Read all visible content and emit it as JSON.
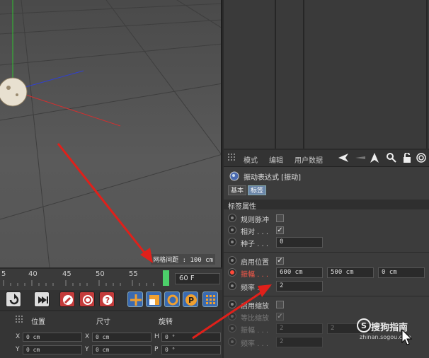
{
  "viewport": {
    "grid_status": "网格间距 : 100 cm"
  },
  "attribute_manager": {
    "menu": {
      "mode": "模式",
      "edit": "编辑",
      "user_data": "用户数据"
    },
    "tag_title": "振动表达式 [振动]",
    "tabs": {
      "basic": "基本",
      "tag": "标签"
    },
    "section_title": "标签属性",
    "params": {
      "regular_pulse": {
        "label": "规则脉冲",
        "checked": false
      },
      "relative": {
        "label": "相对 . . .",
        "checked": true
      },
      "seed": {
        "label": "种子 . . .",
        "value": "0"
      },
      "enable_position": {
        "label": "启用位置",
        "checked": true
      },
      "amplitude": {
        "label": "振幅 . . .",
        "x": "600 cm",
        "y": "500 cm",
        "z": "0 cm"
      },
      "frequency": {
        "label": "频率 . . .",
        "value": "2"
      },
      "enable_scale": {
        "label": "启用缩放",
        "checked": false
      },
      "uniform_scale": {
        "label": "等比缩放",
        "checked": true
      },
      "scale_amplitude": {
        "label": "振幅 . . .",
        "x": "2",
        "y": "2"
      },
      "scale_frequency": {
        "label": "频率 . . .",
        "value": "2"
      }
    }
  },
  "timeline": {
    "ticks": [
      "5",
      "40",
      "45",
      "50",
      "55"
    ],
    "frame_field": "60 F",
    "playhead_frame": 58
  },
  "coordinates": {
    "headers": {
      "position": "位置",
      "size": "尺寸",
      "rotation": "旋转"
    },
    "position": {
      "x_label": "X",
      "x": "0 cm",
      "y_label": "Y",
      "y": "0 cm"
    },
    "size": {
      "x_label": "X",
      "x": "0 cm",
      "y_label": "Y",
      "y": "0 cm"
    },
    "rotation": {
      "h_label": "H",
      "h": "0 °",
      "p_label": "P",
      "p": "0 °"
    }
  },
  "watermark": {
    "title": "搜狗指南",
    "url": "zhinan.sogou.com"
  },
  "colors": {
    "annotation_arrow": "#e0201a",
    "playhead": "#4cd06a",
    "active_tab": "#6a85a8",
    "axis_x": "#d03030",
    "axis_y": "#30c030",
    "axis_z": "#3040d0"
  }
}
